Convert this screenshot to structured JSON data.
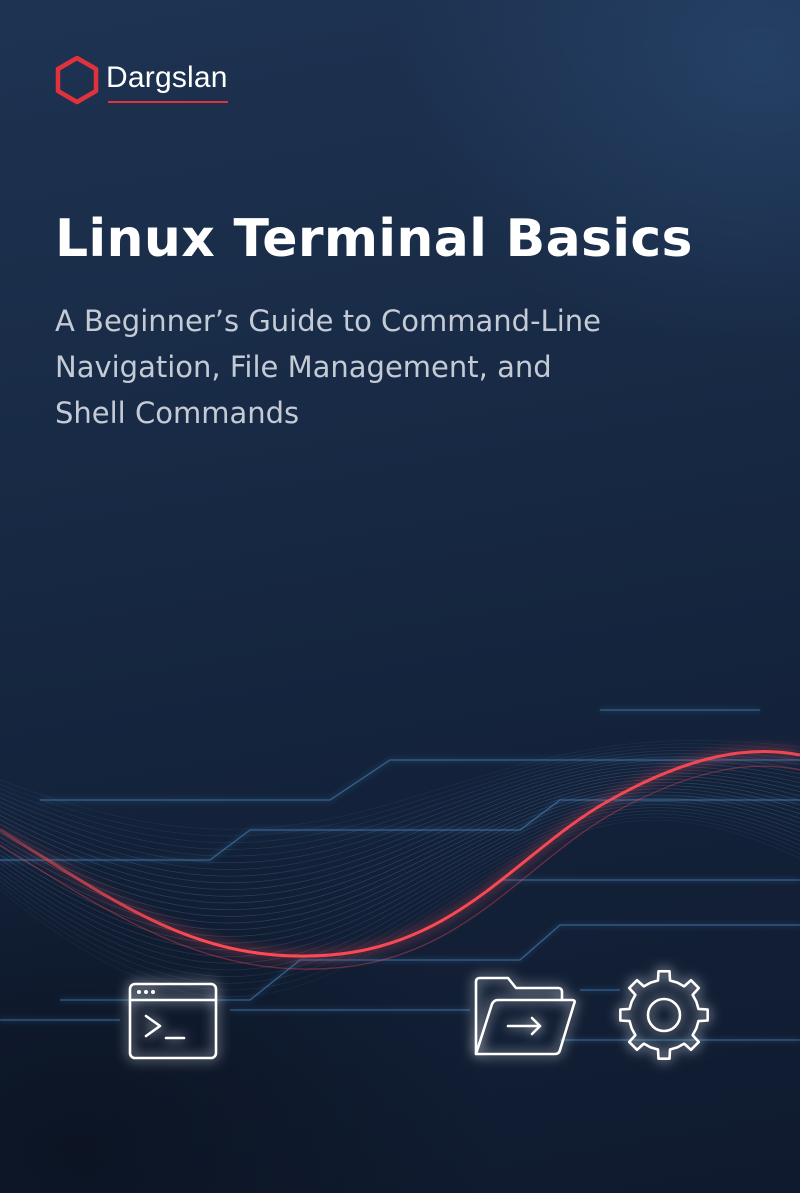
{
  "brand": {
    "name": "Dargslan",
    "accent_color": "#e0323c",
    "logo_icon": "hexagon-logo-icon"
  },
  "title": "Linux Terminal Basics",
  "subtitle_lines": [
    "A Beginner’s Guide to Command-Line",
    "Navigation, File Management, and",
    "Shell Commands"
  ],
  "colors": {
    "background": "#182a45",
    "title": "#ffffff",
    "subtitle": "#c4cbd5",
    "glow_red": "#ff4a55",
    "line_blue": "#4a8ec8"
  },
  "icons": [
    "terminal-window-icon",
    "folder-arrow-icon",
    "gear-icon"
  ]
}
